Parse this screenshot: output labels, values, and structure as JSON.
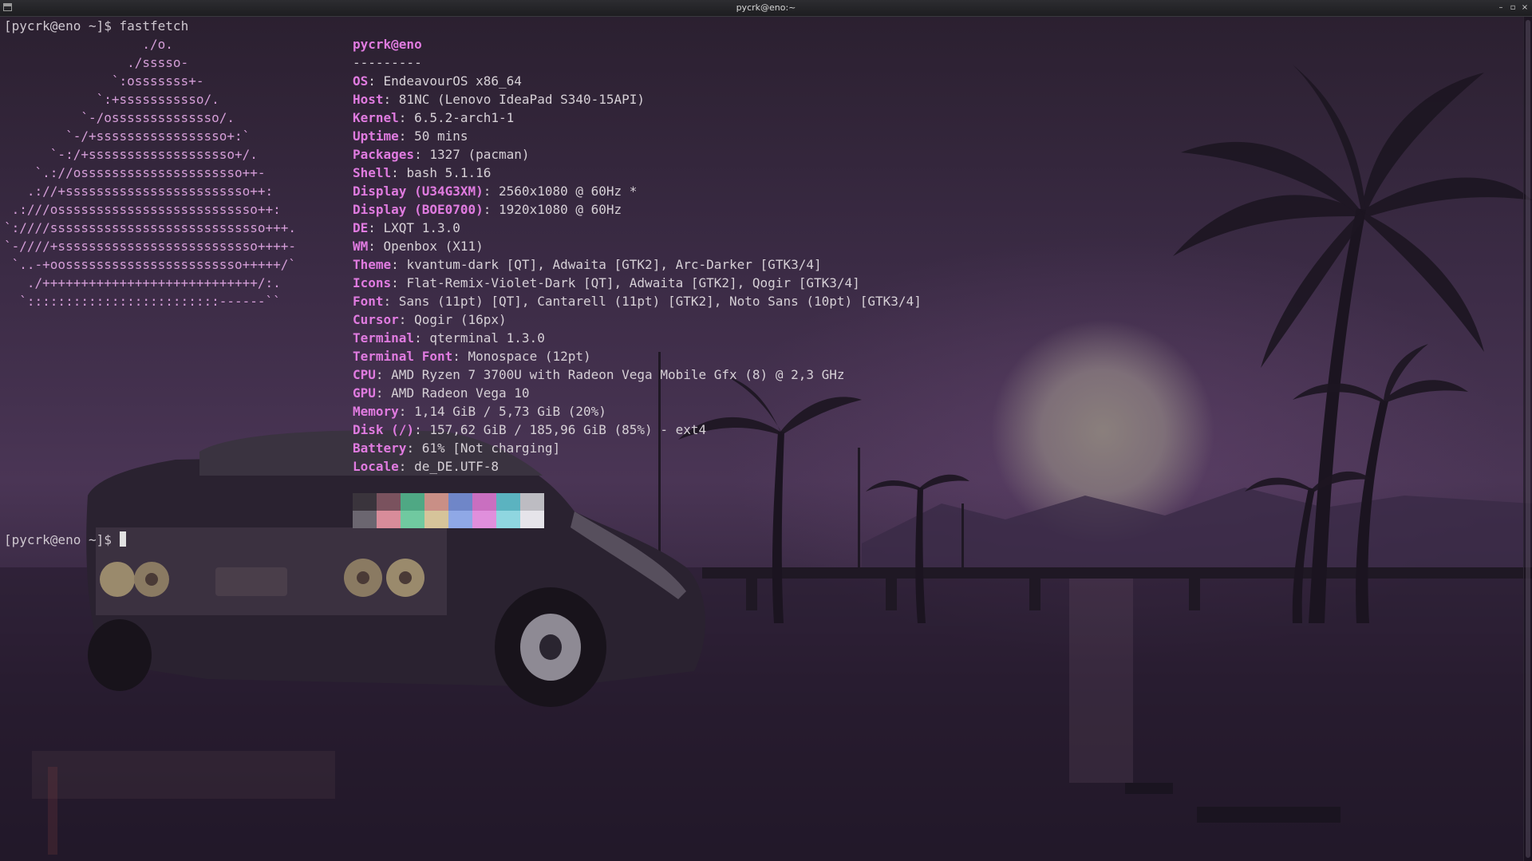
{
  "window": {
    "title": "pycrk@eno:~"
  },
  "wm_buttons": {
    "minimize": "–",
    "maximize": "▫",
    "close": "×"
  },
  "terminal": {
    "prompt1": "[pycrk@eno ~]$ ",
    "command1": "fastfetch",
    "prompt2": "[pycrk@eno ~]$ ",
    "logo_lines": [
      "                  ./o.",
      "                ./sssso-",
      "              `:osssssss+-",
      "            `:+sssssssssso/.",
      "          `-/ossssssssssssso/.",
      "        `-/+sssssssssssssssso+:`",
      "      `-:/+sssssssssssssssssso+/.",
      "    `.://osssssssssssssssssssso++-",
      "   .://+ssssssssssssssssssssssso++:",
      " .:///ossssssssssssssssssssssssso++:",
      "`:////ssssssssssssssssssssssssssso+++.",
      "`-////+ssssssssssssssssssssssssso++++-",
      " `..-+oosssssssssssssssssssssso+++++/`",
      "   ./++++++++++++++++++++++++++++/:.",
      "  `:::::::::::::::::::::::::------``"
    ],
    "info": {
      "hostname": "pycrk@eno",
      "separator": "---------",
      "rows": [
        {
          "label": "OS",
          "value": ": EndeavourOS x86_64"
        },
        {
          "label": "Host",
          "value": ": 81NC (Lenovo IdeaPad S340-15API)"
        },
        {
          "label": "Kernel",
          "value": ": 6.5.2-arch1-1"
        },
        {
          "label": "Uptime",
          "value": ": 50 mins"
        },
        {
          "label": "Packages",
          "value": ": 1327 (pacman)"
        },
        {
          "label": "Shell",
          "value": ": bash 5.1.16"
        },
        {
          "label": "Display (U34G3XM)",
          "value": ": 2560x1080 @ 60Hz *"
        },
        {
          "label": "Display (BOE0700)",
          "value": ": 1920x1080 @ 60Hz"
        },
        {
          "label": "DE",
          "value": ": LXQT 1.3.0"
        },
        {
          "label": "WM",
          "value": ": Openbox (X11)"
        },
        {
          "label": "Theme",
          "value": ": kvantum-dark [QT], Adwaita [GTK2], Arc-Darker [GTK3/4]"
        },
        {
          "label": "Icons",
          "value": ": Flat-Remix-Violet-Dark [QT], Adwaita [GTK2], Qogir [GTK3/4]"
        },
        {
          "label": "Font",
          "value": ": Sans (11pt) [QT], Cantarell (11pt) [GTK2], Noto Sans (10pt) [GTK3/4]"
        },
        {
          "label": "Cursor",
          "value": ": Qogir (16px)"
        },
        {
          "label": "Terminal",
          "value": ": qterminal 1.3.0"
        },
        {
          "label": "Terminal Font",
          "value": ": Monospace (12pt)"
        },
        {
          "label": "CPU",
          "value": ": AMD Ryzen 7 3700U with Radeon Vega Mobile Gfx (8) @ 2,3 GHz"
        },
        {
          "label": "GPU",
          "value": ": AMD Radeon Vega 10"
        },
        {
          "label": "Memory",
          "value": ": 1,14 GiB / 5,73 GiB (20%)"
        },
        {
          "label": "Disk (/)",
          "value": ": 157,62 GiB / 185,96 GiB (85%) - ext4"
        },
        {
          "label": "Battery",
          "value": ": 61% [Not charging]"
        },
        {
          "label": "Locale",
          "value": ": de_DE.UTF-8"
        }
      ]
    },
    "palette_top": [
      "#3a343c",
      "#7a525e",
      "#4fa884",
      "#c98f86",
      "#6f86c8",
      "#c96fc0",
      "#5bb3c0",
      "#bdbcc2"
    ],
    "palette_bottom": [
      "#6b6670",
      "#d88c9a",
      "#70c9a0",
      "#d6c49a",
      "#8fa8e6",
      "#e08fdc",
      "#8fd6e0",
      "#e6e4ea"
    ]
  },
  "colors": {
    "logo": "#d59ed8",
    "label": "#e07be0",
    "text": "#d6d0d6"
  }
}
